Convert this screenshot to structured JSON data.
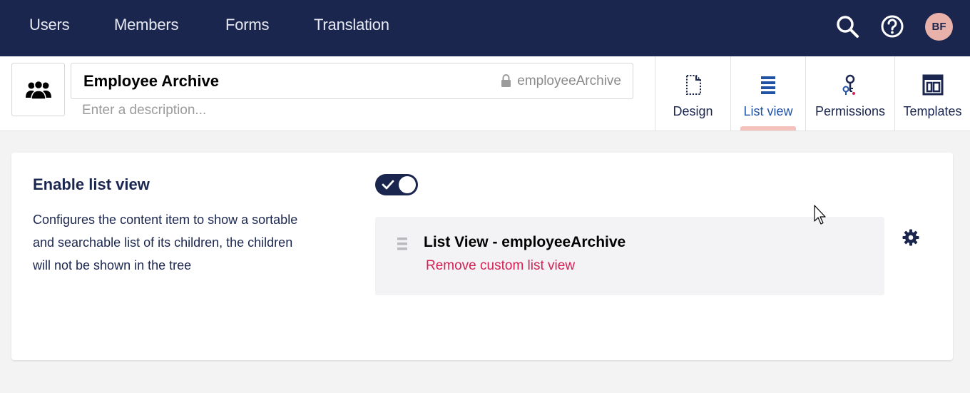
{
  "nav": {
    "items": [
      {
        "label": "Users"
      },
      {
        "label": "Members"
      },
      {
        "label": "Forms"
      },
      {
        "label": "Translation"
      }
    ],
    "search_icon": "search-icon",
    "help_icon": "help-icon",
    "avatar_initials": "BF"
  },
  "header": {
    "type_icon": "users-icon",
    "name": "Employee Archive",
    "alias": "employeeArchive",
    "description_placeholder": "Enter a description...",
    "tabs": [
      {
        "label": "Design",
        "icon": "document-outline-icon"
      },
      {
        "label": "List view",
        "icon": "list-icon",
        "active": true
      },
      {
        "label": "Permissions",
        "icon": "keys-icon"
      },
      {
        "label": "Templates",
        "icon": "layout-icon"
      }
    ]
  },
  "list_view_settings": {
    "title": "Enable list view",
    "description": "Configures the content item to show a sortable and searchable list of its children, the children will not be shown in the tree",
    "enabled": true,
    "list_view_name": "List View - employeeArchive",
    "remove_label": "Remove custom list view"
  },
  "colors": {
    "nav_bg": "#1b264f",
    "accent_link": "#d42054",
    "active_tab": "#2152a3",
    "tab_indicator": "#f5c1bc",
    "avatar_bg": "#e8b2ab"
  }
}
